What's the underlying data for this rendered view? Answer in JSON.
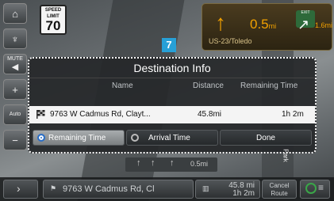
{
  "side_buttons": [
    {
      "icon": "home-icon",
      "glyph": "⌂"
    },
    {
      "icon": "compass-icon",
      "glyph": "♆"
    },
    {
      "icon": "mute-icon",
      "label_top": "MUTE",
      "glyph": "◀"
    },
    {
      "icon": "zoom-in-icon",
      "glyph": "+"
    },
    {
      "icon": "auto-zoom-icon",
      "glyph": "Auto"
    },
    {
      "icon": "zoom-out-icon",
      "glyph": "−"
    }
  ],
  "speed_limit": {
    "label_line1": "SPEED",
    "label_line2": "LIMIT",
    "value": "70"
  },
  "turn_card": {
    "distance": "0.5",
    "distance_unit": "mi",
    "route_name": "US-23/Toledo",
    "exit_label": "EXIT",
    "exit_distance": "1.6",
    "exit_distance_unit": "mi"
  },
  "callout_number": "7",
  "dialog": {
    "title": "Destination Info",
    "columns": {
      "name": "Name",
      "distance": "Distance",
      "remaining": "Remaining Time"
    },
    "row": {
      "name": "9763 W Cadmus Rd, Clayt...",
      "distance": "45.8mi",
      "remaining_time": "1h 2m"
    },
    "tabs": {
      "remaining_time": "Remaining Time",
      "arrival_time": "Arrival Time",
      "done": "Done"
    },
    "selected_tab": "remaining_time"
  },
  "lane_guidance": {
    "distance": "0.5mi"
  },
  "bottom_bar": {
    "destination": "9763 W Cadmus Rd, Cl",
    "remaining_distance": "45.8 mi",
    "remaining_time": "1h 2m",
    "cancel_line1": "Cancel",
    "cancel_line2": "Route"
  },
  "map_label": "Park"
}
